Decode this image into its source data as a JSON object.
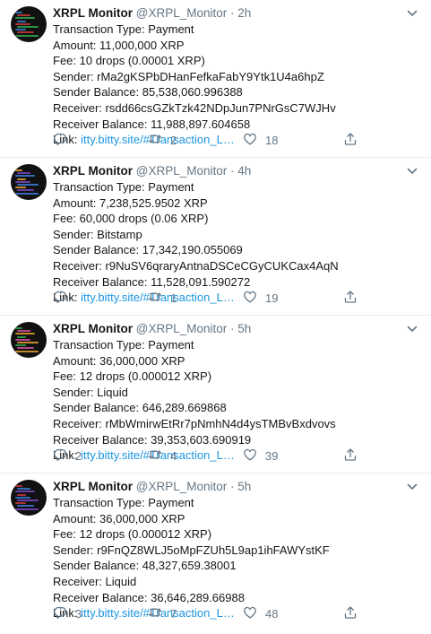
{
  "tweets": [
    {
      "name": "XRPL Monitor",
      "handle": "@XRPL_Monitor",
      "separator": "·",
      "time": "2h",
      "lines": [
        "Transaction Type: Payment",
        "Amount: 11,000,000 XRP",
        "Fee: 10 drops (0.00001 XRP)",
        "Sender: rMa2gKSPbDHanFefkaFabY9Ytk1U4a6hpZ",
        "Sender Balance: 85,538,060.996388",
        "Receiver: rsdd66csGZkTzk42NDpJun7PNrGsC7WJHv",
        "Receiver Balance: 11,988,897.604658"
      ],
      "link_label": "Link:",
      "link_text": "itty.bitty.site/#Transaction_L…",
      "replies": "",
      "retweets": "2",
      "likes": "18"
    },
    {
      "name": "XRPL Monitor",
      "handle": "@XRPL_Monitor",
      "separator": "·",
      "time": "4h",
      "lines": [
        "Transaction Type: Payment",
        "Amount: 7,238,525.9502 XRP",
        "Fee: 60,000 drops (0.06 XRP)",
        "Sender: Bitstamp",
        "Sender Balance: 17,342,190.055069",
        "Receiver: r9NuSV6qraryAntnaDSCeCGyCUKCax4AqN",
        "Receiver Balance: 11,528,091.590272"
      ],
      "link_label": "Link:",
      "link_text": "itty.bitty.site/#Transaction_L…",
      "replies": "",
      "retweets": "1",
      "likes": "19"
    },
    {
      "name": "XRPL Monitor",
      "handle": "@XRPL_Monitor",
      "separator": "·",
      "time": "5h",
      "lines": [
        "Transaction Type: Payment",
        "Amount: 36,000,000 XRP",
        "Fee: 12 drops (0.000012 XRP)",
        "Sender: Liquid",
        "Sender Balance: 646,289.669868",
        "Receiver: rMbWmirwEtRr7pNmhN4d4ysTMBvBxdvovs",
        "Receiver Balance: 39,353,603.690919"
      ],
      "link_label": "Link:",
      "link_text": "itty.bitty.site/#Transaction_L…",
      "replies": "2",
      "retweets": "4",
      "likes": "39"
    },
    {
      "name": "XRPL Monitor",
      "handle": "@XRPL_Monitor",
      "separator": "·",
      "time": "5h",
      "lines": [
        "Transaction Type: Payment",
        "Amount: 36,000,000 XRP",
        "Fee: 12 drops (0.000012 XRP)",
        "Sender: r9FnQZ8WLJ5oMpFZUh5L9ap1ihFAWYstKF",
        "Sender Balance: 48,327,659.38001",
        "Receiver: Liquid",
        "Receiver Balance: 36,646,289.66988"
      ],
      "link_label": "Link:",
      "link_text": "itty.bitty.site/#Transaction_L…",
      "replies": "3",
      "retweets": "7",
      "likes": "48"
    }
  ],
  "icons": {
    "reply": "reply-icon",
    "retweet": "retweet-icon",
    "like": "heart-icon",
    "share": "share-icon",
    "menu": "chevron-down-icon",
    "avatar": "terminal-avatar"
  },
  "colors": {
    "text": "#14171a",
    "muted": "#657786",
    "link": "#1b95e0",
    "divider": "#e6ecf0",
    "avatar_bg": "#111111"
  }
}
